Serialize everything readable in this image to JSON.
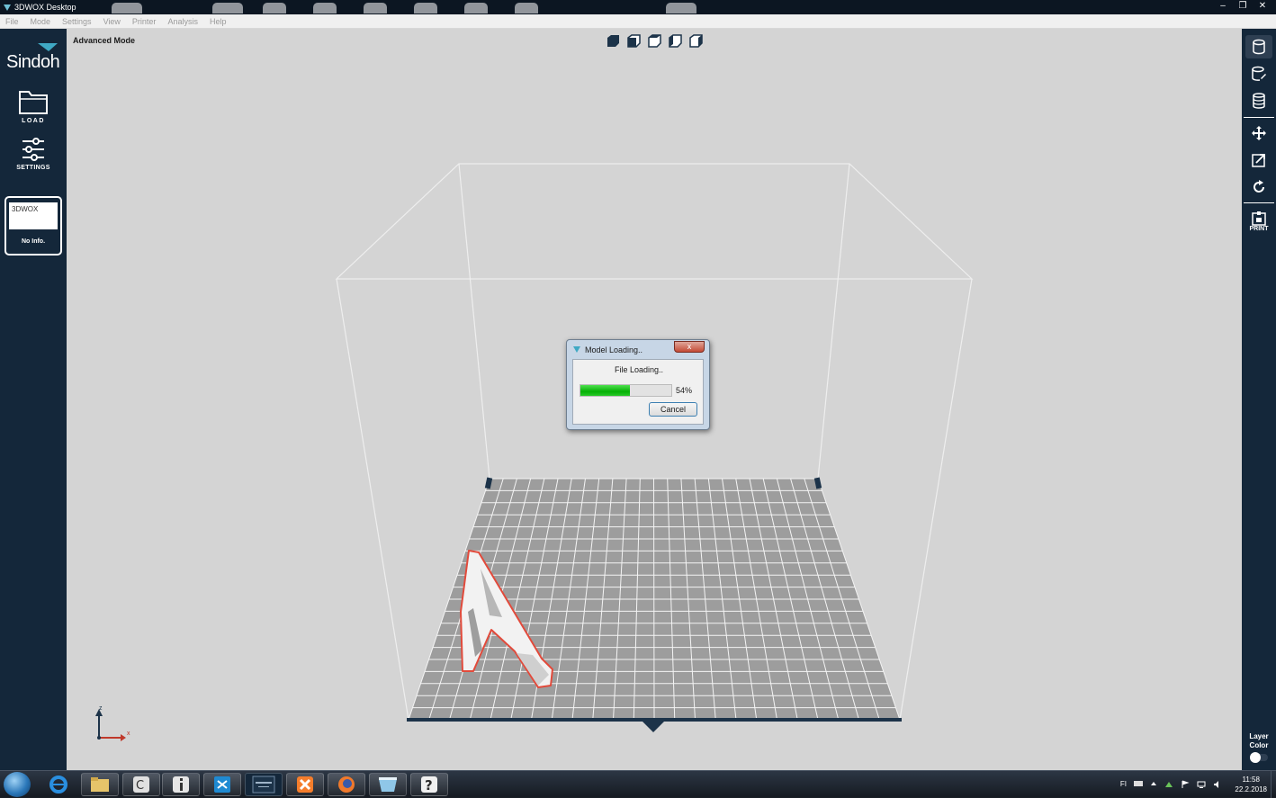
{
  "window": {
    "title": "3DWOX Desktop",
    "controls": {
      "minimize": "‒",
      "restore": "❐",
      "close": "✕"
    }
  },
  "menu": [
    "File",
    "Mode",
    "Settings",
    "View",
    "Printer",
    "Analysis",
    "Help"
  ],
  "sidebar_left": {
    "brand": "Sindoh",
    "load_label": "LOAD",
    "settings_label": "SETTINGS",
    "printer": {
      "name": "3DWOX",
      "info": "No Info."
    }
  },
  "viewport": {
    "mode_label": "Advanced Mode",
    "axis_z": "z",
    "axis_x": "x"
  },
  "dialog": {
    "title": "Model Loading..",
    "message": "File Loading..",
    "progress": 54,
    "progress_text": "54%",
    "cancel_label": "Cancel",
    "close_glyph": "x"
  },
  "sidebar_right": {
    "print_label": "PRINT",
    "layer_color_label": "Layer Color"
  },
  "taskbar": {
    "apps": [
      "internet-explorer",
      "file-explorer",
      "ccleaner",
      "info",
      "vscode",
      "3dwox-desktop",
      "xampp",
      "firefox",
      "slicer",
      "help"
    ],
    "tray_lang": "FI",
    "time": "11:58",
    "date": "22.2.2018"
  },
  "colors": {
    "sidebar": "#14273a",
    "viewport": "#d4d4d4",
    "model_outline": "#e24a3b",
    "progress": "#06b006"
  }
}
